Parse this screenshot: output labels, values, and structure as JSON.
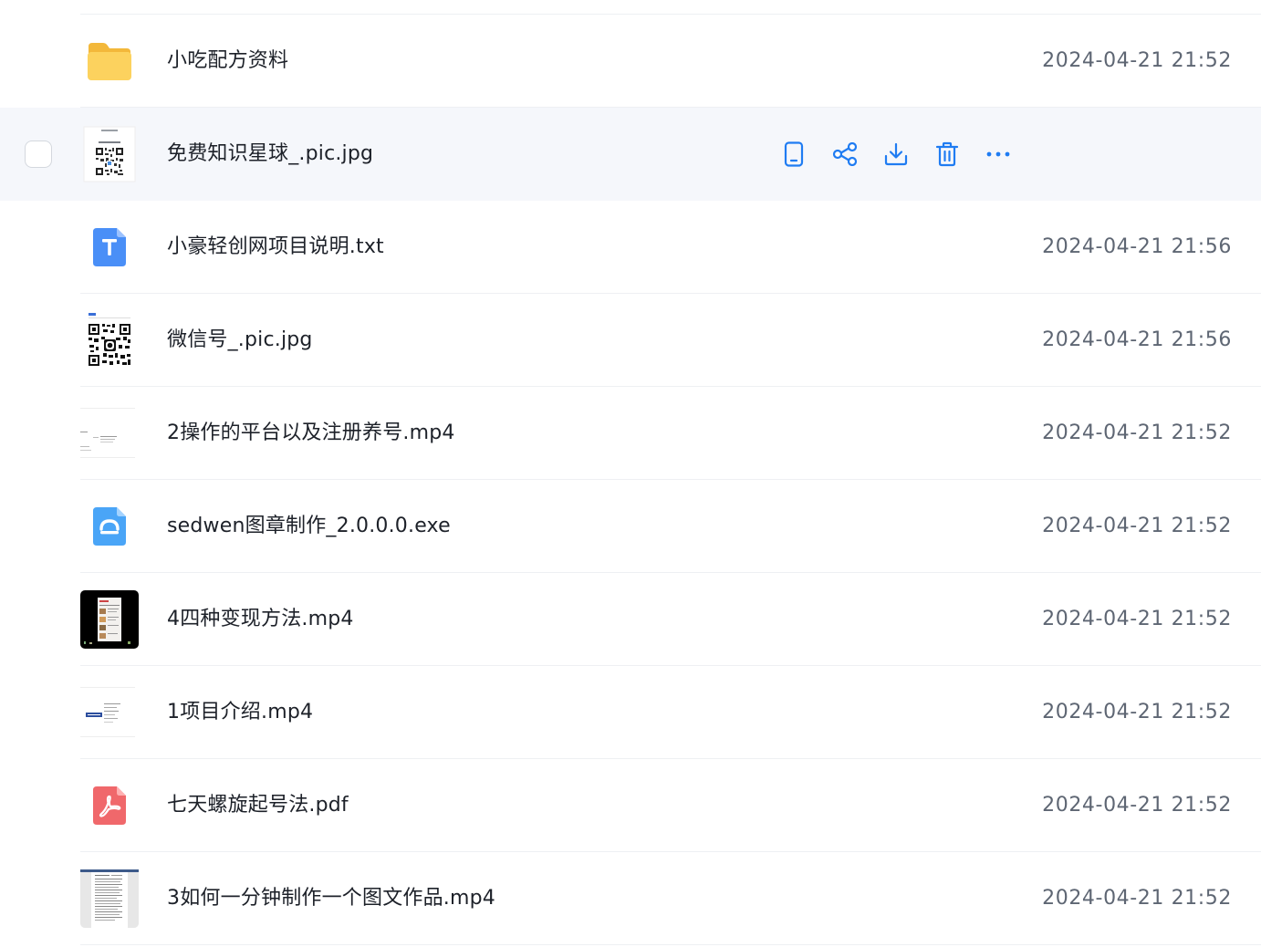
{
  "colors": {
    "accent": "#1f7cf2",
    "hover_row": "#f5f7fb",
    "divider": "#eef0f3",
    "text_primary": "#1d2129",
    "text_secondary": "#5e6673"
  },
  "files": [
    {
      "name": "小吃配方资料",
      "date": "2024-04-21 21:52",
      "icon": "folder-icon"
    },
    {
      "name": "免费知识星球_.pic.jpg",
      "date": "",
      "icon": "qr-image-thumbnail",
      "hovered": true
    },
    {
      "name": "小豪轻创网项目说明.txt",
      "date": "2024-04-21 21:56",
      "icon": "txt-file-icon"
    },
    {
      "name": "微信号_.pic.jpg",
      "date": "2024-04-21 21:56",
      "icon": "qr-image-thumbnail"
    },
    {
      "name": "2操作的平台以及注册养号.mp4",
      "date": "2024-04-21 21:52",
      "icon": "video-thumbnail"
    },
    {
      "name": "sedwen图章制作_2.0.0.0.exe",
      "date": "2024-04-21 21:52",
      "icon": "exe-file-icon"
    },
    {
      "name": "4四种变现方法.mp4",
      "date": "2024-04-21 21:52",
      "icon": "video-thumbnail"
    },
    {
      "name": "1项目介绍.mp4",
      "date": "2024-04-21 21:52",
      "icon": "video-thumbnail"
    },
    {
      "name": "七天螺旋起号法.pdf",
      "date": "2024-04-21 21:52",
      "icon": "pdf-file-icon"
    },
    {
      "name": "3如何一分钟制作一个图文作品.mp4",
      "date": "2024-04-21 21:52",
      "icon": "video-thumbnail"
    }
  ],
  "hover_actions": [
    {
      "icon": "phone-icon"
    },
    {
      "icon": "share-icon"
    },
    {
      "icon": "download-icon"
    },
    {
      "icon": "trash-icon"
    },
    {
      "icon": "more-icon"
    }
  ]
}
